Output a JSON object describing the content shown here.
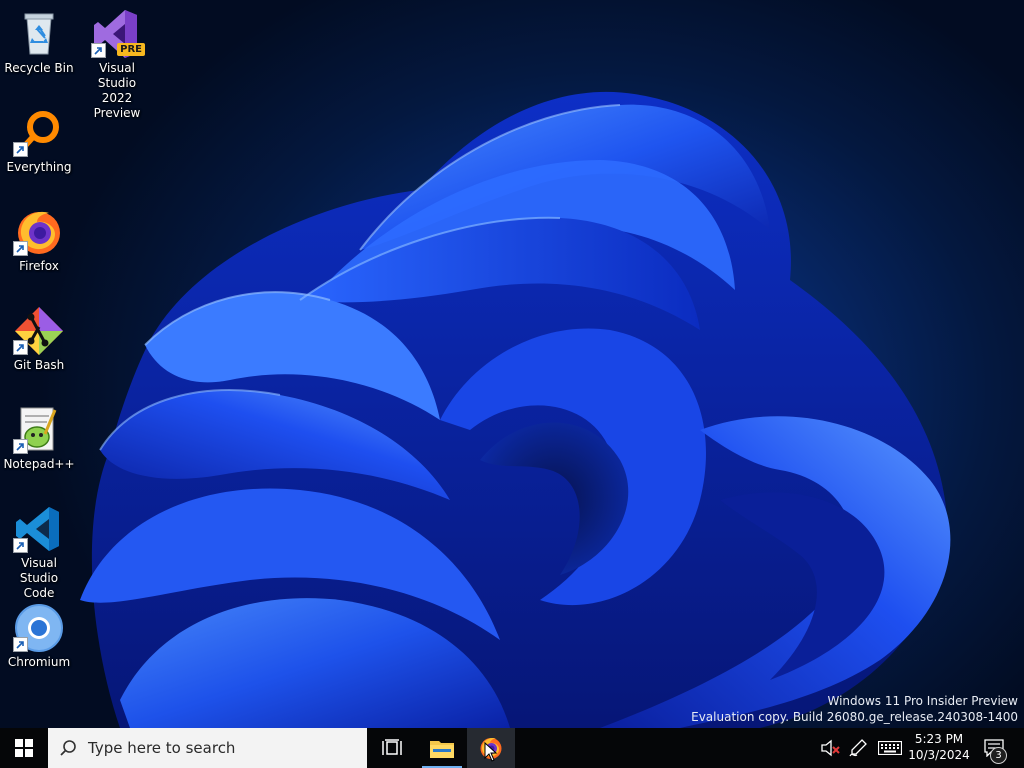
{
  "desktop": {
    "icons": [
      {
        "name": "recycle-bin-icon",
        "label": "Recycle Bin"
      },
      {
        "name": "everything-icon",
        "label": "Everything"
      },
      {
        "name": "firefox-icon",
        "label": "Firefox"
      },
      {
        "name": "git-bash-icon",
        "label": "Git Bash"
      },
      {
        "name": "notepad-plus-plus-icon",
        "label": "Notepad++"
      },
      {
        "name": "vscode-icon",
        "label_line1": "Visual Studio",
        "label_line2": "Code"
      },
      {
        "name": "chromium-icon",
        "label": "Chromium"
      },
      {
        "name": "visual-studio-icon",
        "label_line1": "Visual Studio",
        "label_line2": "2022 Preview",
        "badge": "PRE"
      }
    ],
    "watermark": {
      "line1": "Windows 11 Pro Insider Preview",
      "line2": "Evaluation copy. Build 26080.ge_release.240308-1400"
    }
  },
  "taskbar": {
    "search_placeholder": "Type here to search",
    "buttons": [
      "start-icon",
      "task-view-icon",
      "file-explorer-icon",
      "firefox-icon"
    ],
    "tray": {
      "icons": [
        "volume-muted-icon",
        "pen-icon",
        "keyboard-icon"
      ],
      "time": "5:23 PM",
      "date": "10/3/2024",
      "notification_count": "3"
    }
  },
  "colors": {
    "taskbar": "#050608",
    "search_box": "#f3f3f3",
    "wallpaper_blue": "#1040e0",
    "active_indicator": "#6fb0f0"
  }
}
